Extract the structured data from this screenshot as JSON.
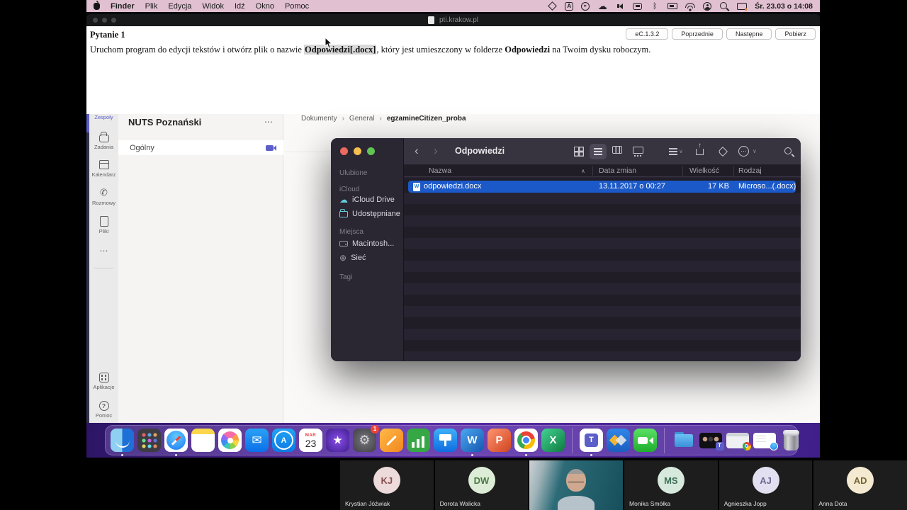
{
  "menubar": {
    "items": [
      "Finder",
      "Plik",
      "Edycja",
      "Widok",
      "Idź",
      "Okno",
      "Pomoc"
    ],
    "clock": "Śr. 23.03 o 14:08",
    "status_icons": [
      "shortcuts-icon",
      "keyboard-a-icon",
      "play-circle-icon",
      "cloud-icon",
      "volume-icon",
      "keyboard-battery-icon",
      "bluetooth-icon",
      "battery-icon",
      "wifi-icon",
      "user-circle-icon",
      "spotlight-search-icon",
      "display-icon"
    ]
  },
  "browser": {
    "title": "pti.krakow.pl",
    "version_button": "eC.1.3.2",
    "prev_button": "Poprzednie",
    "next_button": "Następne",
    "download_button": "Pobierz",
    "question": {
      "title": "Pytanie 1",
      "pre": "Uruchom program do edycji tekstów i otwórz plik o nazwie ",
      "file": "Odpowiedzi[.docx]",
      "mid": ", który jest umieszczony w folderze ",
      "folder": "Odpowiedzi",
      "post": " na Twoim dysku roboczym."
    }
  },
  "teams": {
    "rail": {
      "teams_label": "Zespoły",
      "tasks": "Zadania",
      "calendar": "Kalendarz",
      "calls": "Rozmowy",
      "files": "Pliki",
      "more": "⋯",
      "apps": "Aplikacje",
      "help": "Pomoc"
    },
    "team_name": "NUTS Poznański",
    "team_more": "⋯",
    "channel": "Ogólny",
    "breadcrumb": {
      "a": "Dokumenty",
      "b": "General",
      "c": "egzamineCitizen_proba"
    }
  },
  "finder": {
    "title": "Odpowiedzi",
    "back": "‹",
    "forward": "›",
    "sidebar": {
      "favorites": "Ulubione",
      "icloud": "iCloud",
      "icloud_drive": "iCloud Drive",
      "shared": "Udostępniane",
      "places": "Miejsca",
      "hd": "Macintosh...",
      "network": "Sieć",
      "tags": "Tagi"
    },
    "columns": {
      "name": "Nazwa",
      "date": "Data zmian",
      "size": "Wielkość",
      "kind": "Rodzaj"
    },
    "sort_caret": "∧",
    "row": {
      "name": "odpowiedzi.docx",
      "date": "13.11.2017 o 00:27",
      "size": "17 KB",
      "kind": "Microso...(.docx)"
    }
  },
  "dock": {
    "calendar_month": "MAR",
    "calendar_day": "23",
    "prefs_badge": "1",
    "items": [
      "finder",
      "launchpad",
      "safari",
      "notes",
      "photos",
      "mail",
      "app-store",
      "calendar",
      "imovie",
      "system-preferences",
      "pages",
      "numbers",
      "keynote",
      "word",
      "powerpoint",
      "chrome",
      "excel",
      "teams",
      "company-portal",
      "facetime",
      "downloads-folder",
      "minimized-teams-window",
      "minimized-chrome-window",
      "minimized-safari-window",
      "trash"
    ],
    "running": [
      "finder",
      "safari",
      "word",
      "chrome",
      "teams"
    ]
  },
  "call": {
    "participants": [
      {
        "initials": "KJ",
        "name": "Krystian Jóźwiak",
        "bg": "#eddada",
        "fg": "#8a5151"
      },
      {
        "initials": "DW",
        "name": "Dorota Walicka",
        "bg": "#dcecd6",
        "fg": "#4a7a44"
      },
      {
        "video": true
      },
      {
        "initials": "MS",
        "name": "Monika Smółka",
        "bg": "#d6e9dc",
        "fg": "#3c6f55"
      },
      {
        "initials": "AJ",
        "name": "Agnieszka Jopp",
        "bg": "#e2dff0",
        "fg": "#6a6a92"
      },
      {
        "initials": "AD",
        "name": "Anna Dota",
        "bg": "#f4ead2",
        "fg": "#77652e"
      }
    ]
  },
  "colors": {
    "teams_accent": "#5b5fc7",
    "finder_selection": "#1c59c8",
    "menubar_bg": "#e1c0d1",
    "wallpaper_purple": "#5a2ba4"
  }
}
